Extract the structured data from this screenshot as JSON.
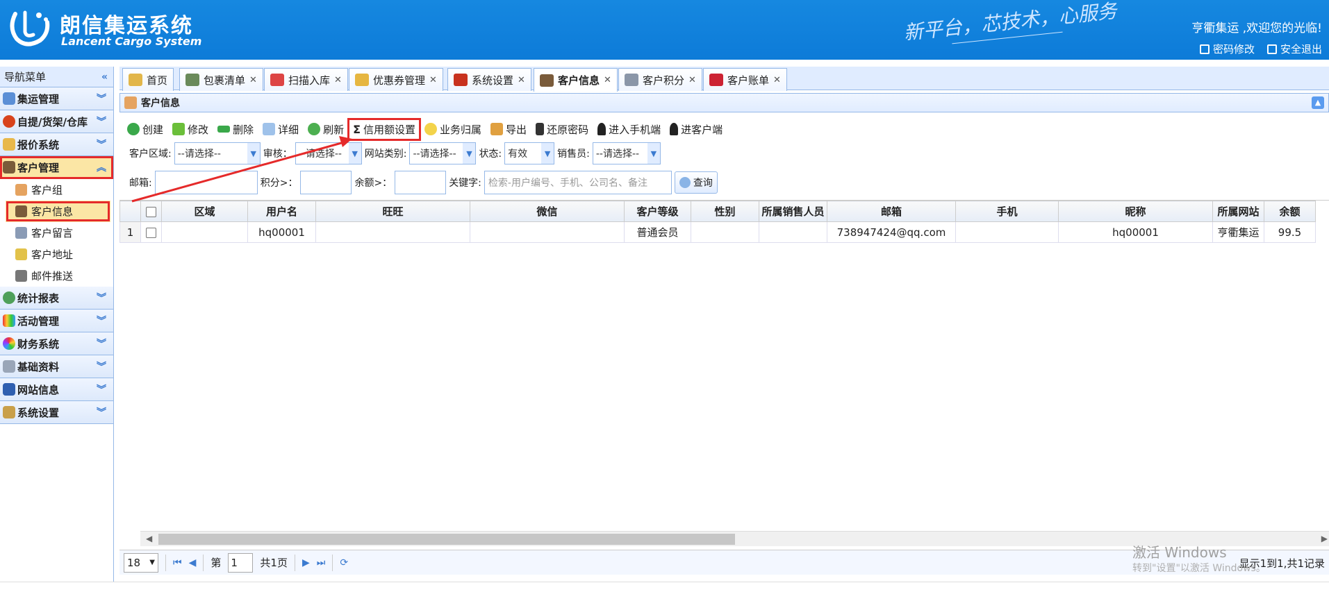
{
  "header": {
    "brand_cn": "朗信集运系统",
    "brand_en": "Lancent Cargo System",
    "slogan": "新平台，芯技术，心服务",
    "welcome": "亨衢集运 ,欢迎您的光临!",
    "change_password": "密码修改",
    "logout": "安全退出"
  },
  "sidebar": {
    "title": "导航菜单",
    "groups": [
      {
        "label": "集运管理",
        "icon": "globe-icon"
      },
      {
        "label": "自提/货架/仓库",
        "icon": "ball-icon"
      },
      {
        "label": "报价系统",
        "icon": "folder-icon"
      },
      {
        "label": "客户管理",
        "icon": "user-icon"
      },
      {
        "label": "统计报表",
        "icon": "globe-icon"
      },
      {
        "label": "活动管理",
        "icon": "rainbow-icon"
      },
      {
        "label": "财务系统",
        "icon": "colorwheel-icon"
      },
      {
        "label": "基础资料",
        "icon": "stack-icon"
      },
      {
        "label": "网站信息",
        "icon": "font-icon"
      },
      {
        "label": "系统设置",
        "icon": "tools-icon"
      }
    ],
    "items": [
      {
        "label": "客户组",
        "icon": "hand-icon"
      },
      {
        "label": "客户信息",
        "icon": "user-icon"
      },
      {
        "label": "客户留言",
        "icon": "message-icon"
      },
      {
        "label": "客户地址",
        "icon": "address-icon"
      },
      {
        "label": "邮件推送",
        "icon": "printer-icon"
      }
    ]
  },
  "tabs": [
    {
      "label": "首页",
      "closable": false
    },
    {
      "label": "包裹清单",
      "closable": true
    },
    {
      "label": "扫描入库",
      "closable": true
    },
    {
      "label": "优惠券管理",
      "closable": true
    },
    {
      "label": "系统设置",
      "closable": true
    },
    {
      "label": "客户信息",
      "closable": true
    },
    {
      "label": "客户积分",
      "closable": true
    },
    {
      "label": "客户账单",
      "closable": true
    }
  ],
  "panel": {
    "title": "客户信息"
  },
  "toolbar": [
    "创建",
    "修改",
    "删除",
    "详细",
    "刷新",
    "信用额设置",
    "业务归属",
    "导出",
    "还原密码",
    "进入手机端",
    "进客户端"
  ],
  "filters": {
    "region_label": "客户区域:",
    "region_value": "--请选择--",
    "audit_label": "审核：",
    "audit_value": "--请选择--",
    "site_label": "网站类别:",
    "site_value": "--请选择--",
    "status_label": "状态:",
    "status_value": "有效",
    "sales_label": "销售员:",
    "sales_value": "--请选择--",
    "email_label": "邮箱:",
    "points_label": "积分>：",
    "balance_label": "余额>：",
    "keyword_label": "关键字:",
    "keyword_placeholder": "检索-用户编号、手机、公司名、备注",
    "query_button": "查询"
  },
  "table": {
    "columns": [
      "区域",
      "用户名",
      "旺旺",
      "微信",
      "客户等级",
      "性别",
      "所属销售人员",
      "邮箱",
      "手机",
      "昵称",
      "所属网站",
      "余额"
    ],
    "rows": [
      [
        "1",
        "",
        "hq00001",
        "",
        "",
        "普通会员",
        "",
        "",
        "738947424@qq.com",
        "",
        "hq00001",
        "亨衢集运",
        "99.5"
      ]
    ]
  },
  "pager": {
    "page_size": "18",
    "page_prefix": "第",
    "page_value": "1",
    "page_suffix": "共1页",
    "info": "显示1到1,共1记录"
  },
  "watermark": {
    "line1": "激活 Windows",
    "line2": "转到\"设置\"以激活 Windows。"
  },
  "colors": {
    "header_blue": "#0d7bd8",
    "highlight_red": "#e52a2a",
    "active_yellow": "#fbe6a5"
  }
}
